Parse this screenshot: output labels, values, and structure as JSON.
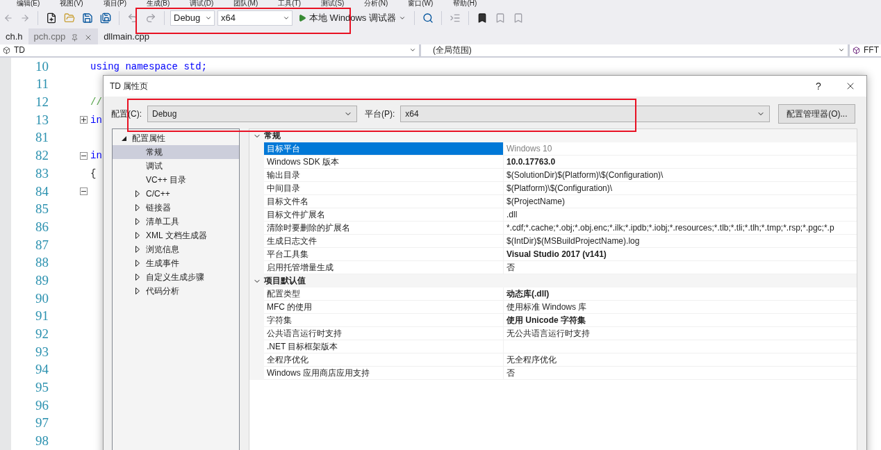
{
  "menu": [
    "编辑(E)",
    "视图(V)",
    "项目(P)",
    "生成(B)",
    "调试(D)",
    "团队(M)",
    "工具(T)",
    "测试(S)",
    "分析(N)",
    "窗口(W)",
    "帮助(H)"
  ],
  "toolbar": {
    "configuration": "Debug",
    "platform": "x64",
    "run_label": "本地 Windows 调试器"
  },
  "tabs": [
    {
      "label": "ch.h",
      "selected": false,
      "pinned": false
    },
    {
      "label": "pch.cpp",
      "selected": true,
      "pinned": true
    },
    {
      "label": "dllmain.cpp",
      "selected": false,
      "pinned": false
    }
  ],
  "navigation": {
    "project": "TD",
    "scope": "(全局范围)",
    "member": "FFT"
  },
  "editor": {
    "lines": [
      {
        "number": "10",
        "code": "using namespace std;",
        "kind": "keyword"
      },
      {
        "number": "11"
      },
      {
        "number": "12",
        "code": "//",
        "kind": "comment"
      },
      {
        "number": "13",
        "code": "in",
        "kind": "keyword",
        "expanded": false
      },
      {
        "number": "81"
      },
      {
        "number": "82",
        "code": "in",
        "kind": "keyword",
        "expanded": true
      },
      {
        "number": "83",
        "code": "{",
        "kind": "plain"
      },
      {
        "number": "84",
        "expanded": true
      },
      {
        "number": "85"
      },
      {
        "number": "86"
      },
      {
        "number": "87"
      },
      {
        "number": "88"
      },
      {
        "number": "89"
      },
      {
        "number": "90"
      },
      {
        "number": "91"
      },
      {
        "number": "92"
      },
      {
        "number": "93"
      },
      {
        "number": "94"
      },
      {
        "number": "95"
      },
      {
        "number": "96"
      },
      {
        "number": "97"
      },
      {
        "number": "98"
      }
    ]
  },
  "dialog": {
    "title": "TD 属性页",
    "help": "?",
    "config_label": "配置(C):",
    "config_value": "Debug",
    "platform_label": "平台(P):",
    "platform_value": "x64",
    "manager_button": "配置管理器(O)...",
    "tree": [
      {
        "label": "配置属性",
        "expanded": true,
        "selected": false,
        "children": [
          {
            "label": "常规",
            "selected": true
          },
          {
            "label": "调试",
            "selected": false
          },
          {
            "label": "VC++ 目录",
            "selected": false
          },
          {
            "label": "C/C++",
            "selected": false,
            "expanded": false
          },
          {
            "label": "链接器",
            "selected": false,
            "expanded": false
          },
          {
            "label": "清单工具",
            "selected": false,
            "expanded": false
          },
          {
            "label": "XML 文档生成器",
            "selected": false,
            "expanded": false
          },
          {
            "label": "浏览信息",
            "selected": false,
            "expanded": false
          },
          {
            "label": "生成事件",
            "selected": false,
            "expanded": false
          },
          {
            "label": "自定义生成步骤",
            "selected": false,
            "expanded": false
          },
          {
            "label": "代码分析",
            "selected": false,
            "expanded": false
          }
        ]
      }
    ],
    "categories": [
      {
        "title": "常规",
        "expanded": true,
        "properties": [
          {
            "name": "目标平台",
            "value": "Windows 10",
            "selected": true,
            "bold": false,
            "greyed": true
          },
          {
            "name": "Windows SDK 版本",
            "value": "10.0.17763.0",
            "selected": false,
            "bold": true,
            "greyed": false
          },
          {
            "name": "输出目录",
            "value": "$(SolutionDir)$(Platform)\\$(Configuration)\\",
            "selected": false,
            "bold": false,
            "greyed": false
          },
          {
            "name": "中间目录",
            "value": "$(Platform)\\$(Configuration)\\",
            "selected": false,
            "bold": false,
            "greyed": false
          },
          {
            "name": "目标文件名",
            "value": "$(ProjectName)",
            "selected": false,
            "bold": false,
            "greyed": false
          },
          {
            "name": "目标文件扩展名",
            "value": ".dll",
            "selected": false,
            "bold": false,
            "greyed": false
          },
          {
            "name": "清除时要删除的扩展名",
            "value": "*.cdf;*.cache;*.obj;*.obj.enc;*.ilk;*.ipdb;*.iobj;*.resources;*.tlb;*.tli;*.tlh;*.tmp;*.rsp;*.pgc;*.p",
            "selected": false,
            "bold": false,
            "greyed": false
          },
          {
            "name": "生成日志文件",
            "value": "$(IntDir)$(MSBuildProjectName).log",
            "selected": false,
            "bold": false,
            "greyed": false
          },
          {
            "name": "平台工具集",
            "value": "Visual Studio 2017 (v141)",
            "selected": false,
            "bold": true,
            "greyed": false
          },
          {
            "name": "启用托管增量生成",
            "value": "否",
            "selected": false,
            "bold": false,
            "greyed": false
          }
        ]
      },
      {
        "title": "项目默认值",
        "expanded": true,
        "properties": [
          {
            "name": "配置类型",
            "value": "动态库(.dll)",
            "selected": false,
            "bold": true,
            "greyed": false
          },
          {
            "name": "MFC 的使用",
            "value": "使用标准 Windows 库",
            "selected": false,
            "bold": false,
            "greyed": false
          },
          {
            "name": "字符集",
            "value": "使用 Unicode 字符集",
            "selected": false,
            "bold": true,
            "greyed": false
          },
          {
            "name": "公共语言运行时支持",
            "value": "无公共语言运行时支持",
            "selected": false,
            "bold": false,
            "greyed": false
          },
          {
            "name": ".NET 目标框架版本",
            "selected": false
          },
          {
            "name": "全程序优化",
            "value": "无全程序优化",
            "selected": false,
            "bold": false,
            "greyed": false
          },
          {
            "name": "Windows 应用商店应用支持",
            "value": "否",
            "selected": false,
            "bold": false,
            "greyed": false
          }
        ]
      }
    ]
  }
}
